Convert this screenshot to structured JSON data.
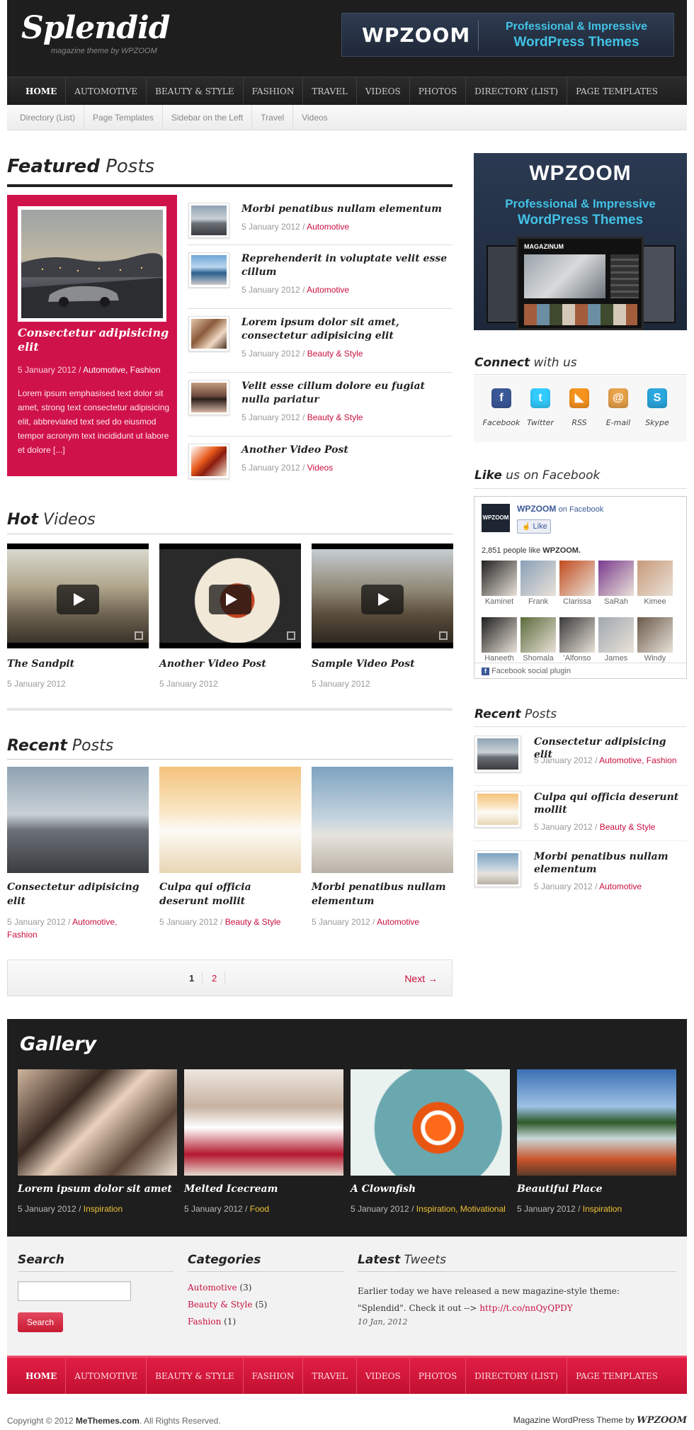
{
  "header": {
    "logo": "Splendid",
    "tagline": "magazine theme by WPZOOM",
    "banner_brand": "WPZOOM",
    "banner_line1": "Professional & Impressive",
    "banner_line2": "WordPress Themes"
  },
  "nav": [
    "HOME",
    "AUTOMOTIVE",
    "BEAUTY & STYLE",
    "FASHION",
    "TRAVEL",
    "VIDEOS",
    "PHOTOS",
    "DIRECTORY (LIST)",
    "PAGE TEMPLATES"
  ],
  "subnav": [
    "Directory (List)",
    "Page Templates",
    "Sidebar on the Left",
    "Travel",
    "Videos"
  ],
  "featured": {
    "heading_bold": "Featured",
    "heading_light": "Posts",
    "main": {
      "title": "Consectetur adipisicing elit",
      "date": "5 January 2012 /",
      "cat1": "Automotive",
      "cat2": "Fashion",
      "excerpt": "Lorem ipsum emphasised text dolor sit amet, strong text consectetur adipisicing elit, abbreviated text sed do eiusmod tempor acronym text incididunt ut labore et dolore [...]"
    },
    "list": [
      {
        "title": "Morbi penatibus nullam elementum",
        "date": "5 January 2012 /",
        "cat": "Automotive"
      },
      {
        "title": "Reprehenderit in voluptate velit esse cillum",
        "date": "5 January 2012 /",
        "cat": "Automotive"
      },
      {
        "title": "Lorem ipsum dolor sit amet, consectetur adipisicing elit",
        "date": "5 January 2012 /",
        "cat": "Beauty & Style"
      },
      {
        "title": "Velit esse cillum dolore eu fugiat nulla pariatur",
        "date": "5 January 2012 /",
        "cat": "Beauty & Style"
      },
      {
        "title": "Another Video Post",
        "date": "5 January 2012 /",
        "cat": "Videos"
      }
    ]
  },
  "hot_videos": {
    "heading_bold": "Hot",
    "heading_light": "Videos",
    "items": [
      {
        "title": "The Sandpit",
        "date": "5 January 2012"
      },
      {
        "title": "Another Video Post",
        "date": "5 January 2012"
      },
      {
        "title": "Sample Video Post",
        "date": "5 January 2012"
      }
    ]
  },
  "recent_posts": {
    "heading_bold": "Recent",
    "heading_light": "Posts",
    "items": [
      {
        "title": "Consectetur adipisicing elit",
        "date": "5 January 2012 /",
        "cat1": "Automotive,",
        "cat2": "Fashion"
      },
      {
        "title": "Culpa qui officia deserunt mollit",
        "date": "5 January 2012 /",
        "cat1": "Beauty & Style",
        "cat2": ""
      },
      {
        "title": "Morbi penatibus nullam elementum",
        "date": "5 January 2012 /",
        "cat1": "Automotive",
        "cat2": ""
      }
    ]
  },
  "pagination": {
    "page1": "1",
    "page2": "2",
    "next": "Next →"
  },
  "sidebar": {
    "ad_brand": "WPZOOM",
    "ad_line1": "Professional & Impressive",
    "ad_line2": "WordPress Themes",
    "ad_screen_title": "MAGAZINUM",
    "connect_bold": "Connect",
    "connect_light": "with us",
    "social": [
      {
        "icon": "facebook-icon",
        "label": "Facebook",
        "color": "#3b5998",
        "glyph": "f"
      },
      {
        "icon": "twitter-icon",
        "label": "Twitter",
        "color": "#33ccff",
        "glyph": "t"
      },
      {
        "icon": "rss-icon",
        "label": "RSS",
        "color": "#f7941d",
        "glyph": "◣"
      },
      {
        "icon": "email-icon",
        "label": "E-mail",
        "color": "#e8a24a",
        "glyph": "@"
      },
      {
        "icon": "skype-icon",
        "label": "Skype",
        "color": "#2ba8e0",
        "glyph": "S"
      }
    ],
    "like_bold": "Like",
    "like_light": "us on Facebook",
    "fb_page": "WPZOOM",
    "fb_on": "on Facebook",
    "fb_like": "Like",
    "fb_count_text": "2,851 people like",
    "fb_count_name": "WPZOOM.",
    "fb_fans": [
      "Kaminet",
      "Frank",
      "Clarissa",
      "SaRah",
      "Kimee",
      "Haneeth",
      "Shomala",
      "'Alfonso",
      "James",
      "Windy"
    ],
    "fb_plugin": "Facebook social plugin",
    "recent_bold": "Recent",
    "recent_light": "Posts",
    "recent": [
      {
        "title": "Consectetur adipisicing elit",
        "date": "5 January 2012 /",
        "cat1": "Automotive,",
        "cat2": "Fashion"
      },
      {
        "title": "Culpa qui officia deserunt mollit",
        "date": "5 January 2012 /",
        "cat1": "Beauty & Style",
        "cat2": ""
      },
      {
        "title": "Morbi penatibus nullam elementum",
        "date": "5 January 2012 /",
        "cat1": "Automotive",
        "cat2": ""
      }
    ]
  },
  "gallery": {
    "heading": "Gallery",
    "items": [
      {
        "title": "Lorem ipsum dolor sit amet",
        "date": "5 January 2012 /",
        "cat": "Inspiration"
      },
      {
        "title": "Melted Icecream",
        "date": "5 January 2012 /",
        "cat": "Food"
      },
      {
        "title": "A Clownfish",
        "date": "5 January 2012 /",
        "cat": "Inspiration, Motivational"
      },
      {
        "title": "Beautiful Place",
        "date": "5 January 2012 /",
        "cat": "Inspiration"
      }
    ]
  },
  "widgets": {
    "search_title": "Search",
    "search_value": "",
    "search_button": "Search",
    "categories_title": "Categories",
    "categories": [
      {
        "name": "Automotive",
        "count": "(3)"
      },
      {
        "name": "Beauty & Style",
        "count": "(5)"
      },
      {
        "name": "Fashion",
        "count": "(1)"
      }
    ],
    "tweets_bold": "Latest",
    "tweets_light": "Tweets",
    "tweet_text": "Earlier today we have released a new magazine-style theme: \"Splendid\". Check it out -->",
    "tweet_link": "http://t.co/nnQyQPDY",
    "tweet_date": "10 Jan, 2012"
  },
  "footer": {
    "copyright_pre": "Copyright © 2012",
    "copyright_site": "MeThemes.com",
    "copyright_post": ". All Rights Reserved.",
    "credit_pre": "Magazine WordPress Theme by",
    "credit_brand": "WPZOOM"
  }
}
